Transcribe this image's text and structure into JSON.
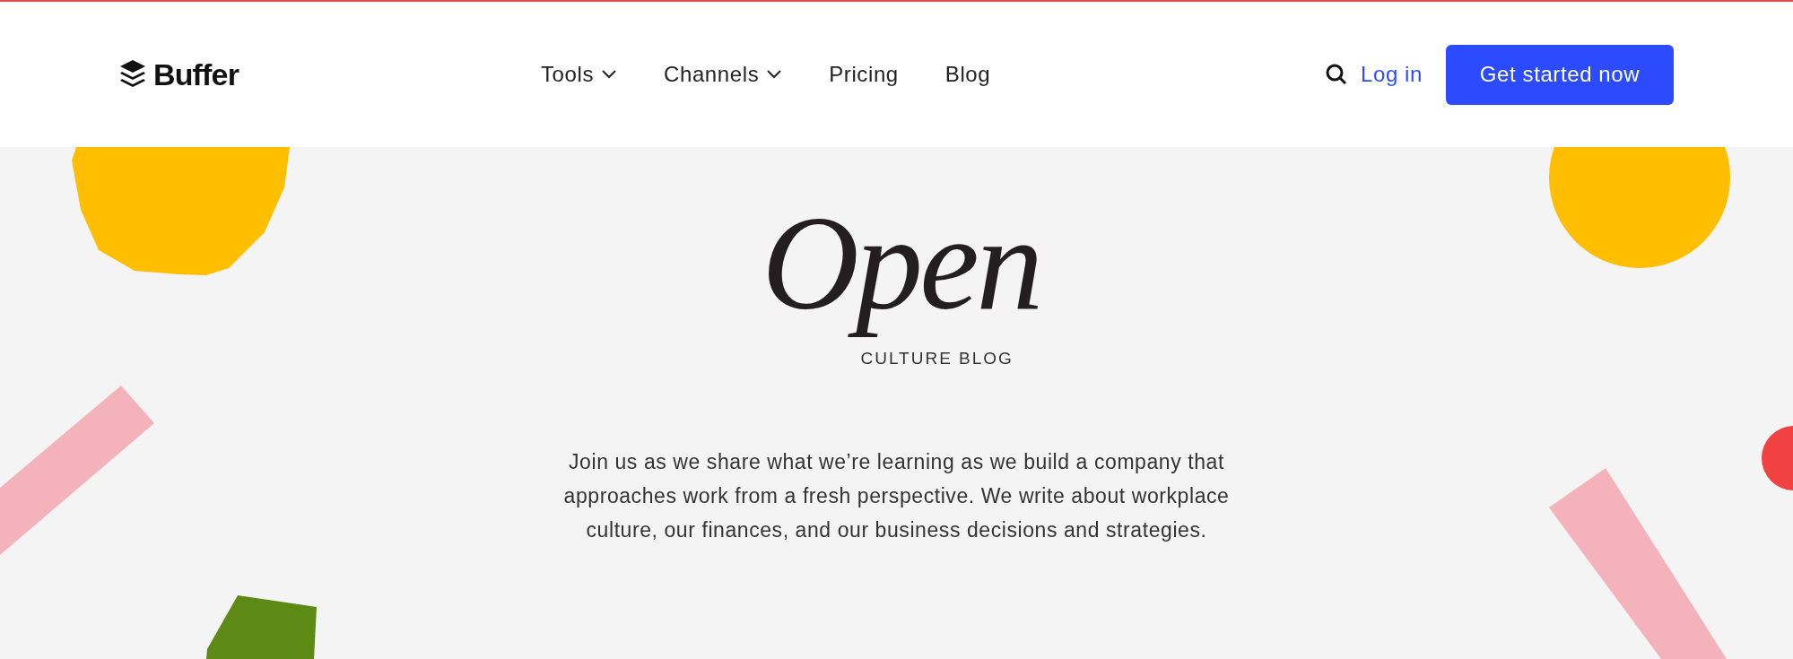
{
  "header": {
    "logo_text": "Buffer",
    "nav": [
      {
        "label": "Tools",
        "kind": "dropdown"
      },
      {
        "label": "Channels",
        "kind": "dropdown"
      },
      {
        "label": "Pricing",
        "kind": "link"
      },
      {
        "label": "Blog",
        "kind": "link"
      }
    ],
    "login": "Log in",
    "cta": "Get started now"
  },
  "hero": {
    "title": "Open",
    "subtitle": "CULTURE BLOG",
    "description": "Join us as we share what we’re learning as we build a company that approaches work from a fresh perspective. We write about workplace culture, our finances, and our business decisions and strategies."
  }
}
